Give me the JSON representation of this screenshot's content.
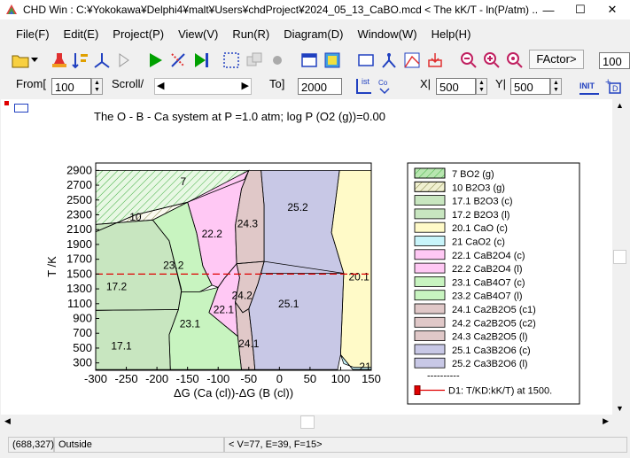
{
  "window": {
    "title": "CHD Win : C:¥Yokokawa¥Delphi4¥malt¥Users¥chdProject¥2024_05_13_CaBO.mcd  < The kK/T - ln(P/atm) ...",
    "minimize": "—",
    "maximize": "☐",
    "close": "✕"
  },
  "menu": [
    "File(F)",
    "Edit(E)",
    "Project(P)",
    "View(V)",
    "Run(R)",
    "Diagram(D)",
    "Window(W)",
    "Help(H)"
  ],
  "toolbar": {
    "factor_label": "FActor>",
    "factor_value": "100"
  },
  "toolbar2": {
    "from_label": "From[",
    "from_value": "100",
    "scroll_label": "Scroll/",
    "to_label": "To]",
    "to_value": "2000",
    "ist_label": "ist",
    "x_label": "X|",
    "x_value": "500",
    "y_label": "Y|",
    "y_value": "500",
    "init_label": "INIT"
  },
  "status": {
    "coords": "(688,327)",
    "location": "Outside",
    "counts": "< V=77, E=39, F=15>"
  },
  "chart_data": {
    "type": "phase-diagram",
    "title": "The O - B - Ca system at P =1.0 atm; log P (O2 (g))=0.00",
    "xlabel": "ΔG (Ca (cl))-ΔG (B (cl))",
    "ylabel": "T /K",
    "xlim": [
      -300,
      150
    ],
    "ylim": [
      200,
      3000
    ],
    "xticks": [
      -300,
      -250,
      -200,
      -150,
      -100,
      -50,
      0,
      50,
      100,
      150
    ],
    "yticks": [
      300,
      500,
      700,
      900,
      1100,
      1300,
      1500,
      1700,
      1900,
      2100,
      2300,
      2500,
      2700,
      2900
    ],
    "dashed_line": {
      "T": 1500,
      "color": "#e00000"
    },
    "legend": [
      {
        "label": "7   BO2 (g)",
        "color": "#b8e6b0",
        "hatch": "green"
      },
      {
        "label": "10   B2O3 (g)",
        "color": "#f0f0d0",
        "hatch": "olive"
      },
      {
        "label": "17.1  B2O3 (c)",
        "color": "#c8e6c0"
      },
      {
        "label": "17.2  B2O3 (l)",
        "color": "#c8e6c0"
      },
      {
        "label": "20.1  CaO (c)",
        "color": "#fffac8"
      },
      {
        "label": "21    CaO2 (c)",
        "color": "#c8f4fa"
      },
      {
        "label": "22.1  CaB2O4 (c)",
        "color": "#ffc8f4"
      },
      {
        "label": "22.2  CaB2O4 (l)",
        "color": "#ffc8f4"
      },
      {
        "label": "23.1  CaB4O7 (c)",
        "color": "#c8f4c0"
      },
      {
        "label": "23.2  CaB4O7 (l)",
        "color": "#c8f4c0"
      },
      {
        "label": "24.1  Ca2B2O5 (c1)",
        "color": "#e0c8c8"
      },
      {
        "label": "24.2  Ca2B2O5 (c2)",
        "color": "#e0c8c8"
      },
      {
        "label": "24.3  Ca2B2O5 (l)",
        "color": "#e0c8c8"
      },
      {
        "label": "25.1  Ca3B2O6 (c)",
        "color": "#c8c8e6"
      },
      {
        "label": "25.2  Ca3B2O6 (l)",
        "color": "#c8c8e6"
      }
    ],
    "legend_footer": {
      "dashes": "----------",
      "line_label": "D1: T/KD:kK/T) at 1500."
    },
    "regions": [
      {
        "label": "7",
        "color": "#e8f8e4",
        "hatch": true,
        "hatch_color": "#40b040",
        "points": [
          [
            -300,
            2900
          ],
          [
            -50,
            2900
          ],
          [
            -57,
            2780
          ],
          [
            -150,
            2470
          ],
          [
            -235,
            2300
          ],
          [
            -300,
            2070
          ]
        ],
        "lx": -157,
        "ly": 2750
      },
      {
        "label": "10",
        "color": "#fafaf0",
        "hatch": true,
        "hatch_color": "#808040",
        "points": [
          [
            -300,
            2070
          ],
          [
            -235,
            2300
          ],
          [
            -150,
            2470
          ],
          [
            -207,
            2230
          ],
          [
            -300,
            2170
          ]
        ],
        "lx": -235,
        "ly": 2270
      },
      {
        "label": "17.2",
        "color": "#c8e6c0",
        "points": [
          [
            -300,
            2170
          ],
          [
            -207,
            2230
          ],
          [
            -180,
            1950
          ],
          [
            -160,
            1290
          ],
          [
            -165,
            1020
          ],
          [
            -300,
            1010
          ]
        ],
        "lx": -266,
        "ly": 1330
      },
      {
        "label": "17.1",
        "color": "#c8e6c0",
        "points": [
          [
            -300,
            1010
          ],
          [
            -165,
            1020
          ],
          [
            -180,
            680
          ],
          [
            -178,
            210
          ],
          [
            -300,
            210
          ]
        ],
        "lx": -258,
        "ly": 530
      },
      {
        "label": "23.2",
        "color": "#c8f4c0",
        "points": [
          [
            -207,
            2230
          ],
          [
            -150,
            2470
          ],
          [
            -135,
            2050
          ],
          [
            -125,
            1610
          ],
          [
            -110,
            1350
          ],
          [
            -130,
            1260
          ],
          [
            -160,
            1260
          ],
          [
            -180,
            1950
          ]
        ],
        "lx": -173,
        "ly": 1620
      },
      {
        "label": "23.1",
        "color": "#c8f4c0",
        "points": [
          [
            -165,
            1020
          ],
          [
            -160,
            1260
          ],
          [
            -130,
            1260
          ],
          [
            -100,
            1320
          ],
          [
            -115,
            980
          ],
          [
            -68,
            660
          ],
          [
            -62,
            210
          ],
          [
            -178,
            210
          ],
          [
            -180,
            680
          ]
        ],
        "lx": -146,
        "ly": 830
      },
      {
        "label": "22.2",
        "color": "#ffc8f4",
        "points": [
          [
            -150,
            2470
          ],
          [
            -50,
            2900
          ],
          [
            -62,
            2650
          ],
          [
            -72,
            2160
          ],
          [
            -70,
            1640
          ],
          [
            -90,
            1440
          ],
          [
            -100,
            1320
          ],
          [
            -110,
            1350
          ],
          [
            -125,
            1610
          ],
          [
            -135,
            2050
          ]
        ],
        "lx": -110,
        "ly": 2040
      },
      {
        "label": "22.1",
        "color": "#ffc8f4",
        "points": [
          [
            -100,
            1320
          ],
          [
            -90,
            1440
          ],
          [
            -70,
            1640
          ],
          [
            -65,
            1450
          ],
          [
            -72,
            1120
          ],
          [
            -68,
            660
          ],
          [
            -115,
            980
          ]
        ],
        "lx": -91,
        "ly": 1020
      },
      {
        "label": "24.3",
        "color": "#e0c8c8",
        "points": [
          [
            -50,
            2900
          ],
          [
            -30,
            2900
          ],
          [
            -25,
            2420
          ],
          [
            -25,
            1670
          ],
          [
            -70,
            1640
          ],
          [
            -72,
            2160
          ],
          [
            -62,
            2650
          ]
        ],
        "lx": -52,
        "ly": 2180
      },
      {
        "label": "24.2",
        "color": "#e0c8c8",
        "points": [
          [
            -70,
            1640
          ],
          [
            -25,
            1670
          ],
          [
            -35,
            1370
          ],
          [
            -50,
            1030
          ],
          [
            -60,
            980
          ],
          [
            -72,
            1120
          ],
          [
            -65,
            1450
          ]
        ],
        "lx": -61,
        "ly": 1210
      },
      {
        "label": "24.1",
        "color": "#e0c8c8",
        "points": [
          [
            -72,
            1120
          ],
          [
            -60,
            980
          ],
          [
            -50,
            1030
          ],
          [
            -45,
            680
          ],
          [
            -40,
            210
          ],
          [
            -62,
            210
          ],
          [
            -68,
            660
          ]
        ],
        "lx": -50,
        "ly": 560
      },
      {
        "label": "25.2",
        "color": "#c8c8e6",
        "points": [
          [
            -30,
            2900
          ],
          [
            98,
            2900
          ],
          [
            85,
            2060
          ],
          [
            105,
            1510
          ],
          [
            -30,
            1510
          ],
          [
            -25,
            1670
          ],
          [
            -25,
            2420
          ]
        ],
        "lx": 30,
        "ly": 2400
      },
      {
        "label": "25.1",
        "color": "#c8c8e6",
        "points": [
          [
            -25,
            1670
          ],
          [
            105,
            1510
          ],
          [
            100,
            410
          ],
          [
            95,
            210
          ],
          [
            -40,
            210
          ],
          [
            -45,
            680
          ],
          [
            -50,
            1030
          ],
          [
            -35,
            1370
          ]
        ],
        "lx": 15,
        "ly": 1100
      },
      {
        "label": "20.1",
        "color": "#fffac8",
        "points": [
          [
            98,
            2900
          ],
          [
            150,
            2900
          ],
          [
            150,
            210
          ],
          [
            120,
            210
          ],
          [
            100,
            410
          ],
          [
            105,
            1510
          ],
          [
            85,
            2060
          ]
        ],
        "lx": 130,
        "ly": 1460
      },
      {
        "label": "21",
        "color": "#c8f4fa",
        "points": [
          [
            100,
            410
          ],
          [
            120,
            210
          ],
          [
            150,
            210
          ],
          [
            150,
            240
          ],
          [
            122,
            240
          ],
          [
            105,
            290
          ]
        ],
        "lx": 140,
        "ly": 248
      }
    ]
  }
}
